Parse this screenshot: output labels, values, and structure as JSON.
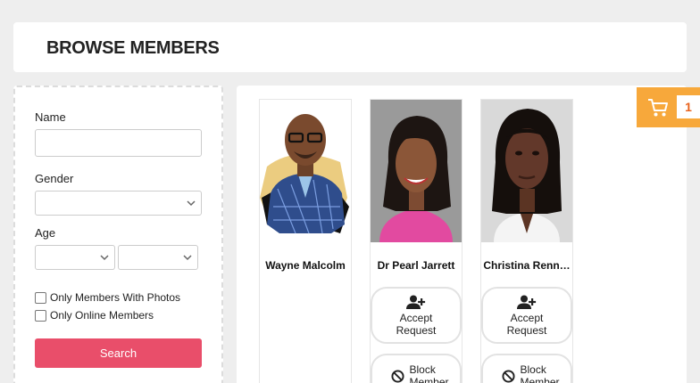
{
  "page": {
    "title": "BROWSE MEMBERS"
  },
  "filters": {
    "name_label": "Name",
    "name_value": "",
    "gender_label": "Gender",
    "gender_value": "",
    "age_label": "Age",
    "age_from_value": "",
    "age_to_value": "",
    "only_photos_label": "Only Members With Photos",
    "only_online_label": "Only Online Members",
    "search_label": "Search"
  },
  "members": [
    {
      "name": "Wayne Malcolm"
    },
    {
      "name": "Dr Pearl Jarrett",
      "accept_label": "Accept Request",
      "block_label": "Block Member"
    },
    {
      "name": "Christina Renn…",
      "accept_label": "Accept Request",
      "block_label": "Block Member"
    }
  ],
  "cart": {
    "count": "1",
    "icon": "cart-icon"
  },
  "colors": {
    "accent": "#e94e6a",
    "cart_bg": "#f7a83b",
    "cart_count": "#e8621c"
  }
}
